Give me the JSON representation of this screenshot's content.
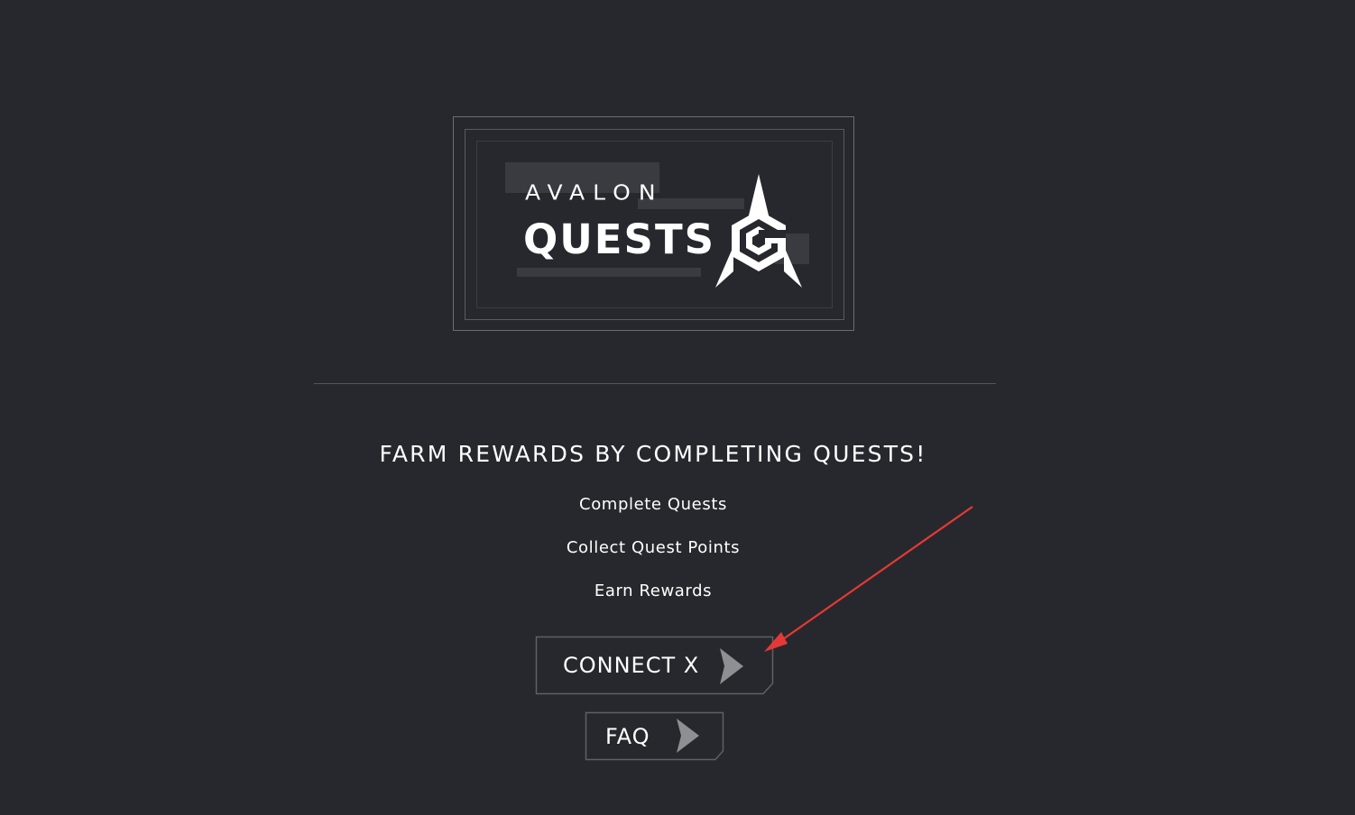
{
  "brand": {
    "line1": "AVALON",
    "line2": "QUESTS",
    "logo_icon": "rocket-spiral-icon"
  },
  "hero": {
    "headline": "FARM REWARDS BY COMPLETING QUESTS!",
    "steps": [
      "Complete Quests",
      "Collect Quest Points",
      "Earn Rewards"
    ]
  },
  "buttons": {
    "connect_label": "CONNECT X",
    "faq_label": "FAQ",
    "icon": "chevron-right-icon"
  },
  "colors": {
    "background": "#27282d",
    "border": "#5f6065",
    "chevron": "#8e8f93",
    "annotation_arrow": "#e53935"
  }
}
